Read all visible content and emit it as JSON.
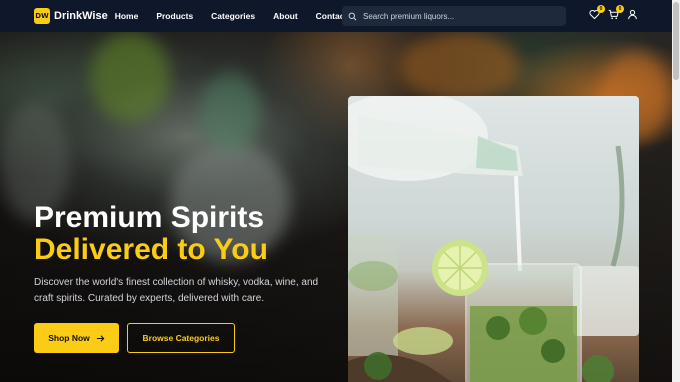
{
  "brand": {
    "badge": "DW",
    "name": "DrinkWise"
  },
  "nav": {
    "links": [
      "Home",
      "Products",
      "Categories",
      "About",
      "Contact"
    ]
  },
  "search": {
    "placeholder": "Search premium liquors..."
  },
  "icons": {
    "wishlist": {
      "name": "heart-icon",
      "count": "0"
    },
    "cart": {
      "name": "cart-icon",
      "count": "0"
    },
    "account": {
      "name": "user-icon"
    }
  },
  "hero": {
    "title_line1": "Premium Spirits",
    "title_line2": "Delivered to You",
    "description": "Discover the world's finest collection of whisky, vodka, wine, and craft spirits. Curated by experts, delivered with care.",
    "primary_button": "Shop Now",
    "secondary_button": "Browse Categories"
  },
  "colors": {
    "accent": "#facc15",
    "nav_bg": "#0f172a",
    "search_bg": "#1e293b"
  }
}
